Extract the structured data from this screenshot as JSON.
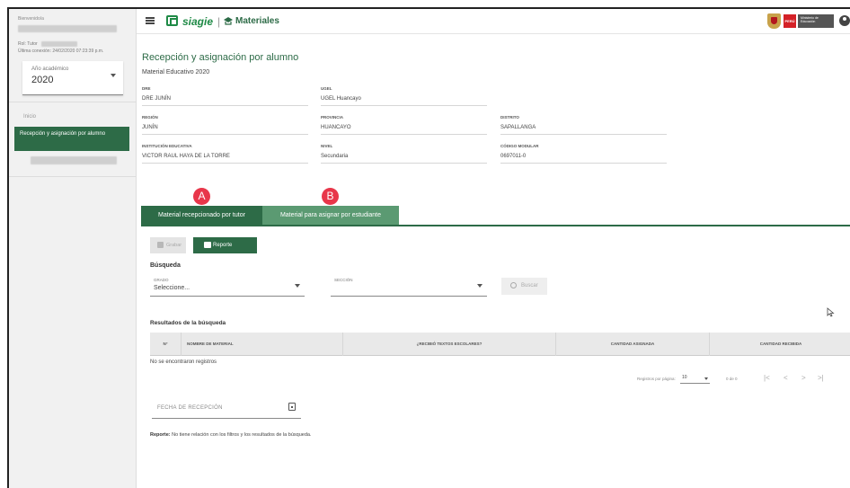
{
  "sidebar": {
    "welcome": "Bienvenido/a",
    "role_label": "Rol: Tutor",
    "last_connection": "Última conexión: 24/02/2020 07:23:39 p.m.",
    "year_label": "Año académico",
    "year_value": "2020",
    "menu": [
      {
        "label": "Inicio"
      },
      {
        "label": "Recepción y asignación por alumno"
      }
    ]
  },
  "header": {
    "brand": "siagie",
    "module": "Materiales",
    "gov_badge": "PERÚ",
    "ministry": "Ministerio de Educación"
  },
  "page": {
    "title": "Recepción y asignación por alumno",
    "subtitle": "Material Educativo 2020"
  },
  "info": {
    "dre": {
      "label": "DRE",
      "value": "DRE JUNÍN"
    },
    "ugel": {
      "label": "UGEL",
      "value": "UGEL Huancayo"
    },
    "region": {
      "label": "REGIÓN",
      "value": "JUNÍN"
    },
    "provincia": {
      "label": "PROVINCIA",
      "value": "HUANCAYO"
    },
    "distrito": {
      "label": "DISTRITO",
      "value": "SAPALLANGA"
    },
    "institucion": {
      "label": "INSTITUCIÓN EDUCATIVA",
      "value": "VICTOR RAUL HAYA DE LA TORRE"
    },
    "nivel": {
      "label": "NIVEL",
      "value": "Secundaria"
    },
    "codigo": {
      "label": "CÓDIGO MODULAR",
      "value": "0697011-0"
    }
  },
  "annotations": {
    "a": "A",
    "b": "B"
  },
  "tabs": [
    {
      "label": "Material recepcionado por tutor",
      "active": true
    },
    {
      "label": "Material para asignar por estudiante",
      "active": false
    }
  ],
  "toolbar": {
    "save_label": "Grabar",
    "report_label": "Reporte"
  },
  "search": {
    "title": "Búsqueda",
    "grado_label": "GRADO",
    "grado_value": "Seleccione...",
    "seccion_label": "SECCIÓN",
    "seccion_value": "",
    "button": "Buscar"
  },
  "results": {
    "title": "Resultados de la búsqueda",
    "columns": [
      "N°",
      "NOMBRE DE MATERIAL",
      "¿RECIBIÓ TEXTOS ESCOLARES?",
      "CANTIDAD ASIGNADA",
      "CANTIDAD RECIBIDA"
    ],
    "empty": "No se encontraron registros"
  },
  "pagination": {
    "per_page_label": "Registros por página:",
    "per_page_value": "10",
    "range": "0 de 0",
    "first": "|<",
    "prev": "<",
    "next": ">",
    "last": ">|"
  },
  "fecha": {
    "label": "FECHA DE RECEPCIÓN"
  },
  "nota": {
    "label": "Reporte:",
    "text": " No tiene relación con los filtros y los resultados de la búsqueda."
  },
  "colors": {
    "primary": "#2d6b47",
    "tab_secondary": "#5b9a72",
    "annotation": "#e8364a",
    "brand": "#1f8a46"
  }
}
